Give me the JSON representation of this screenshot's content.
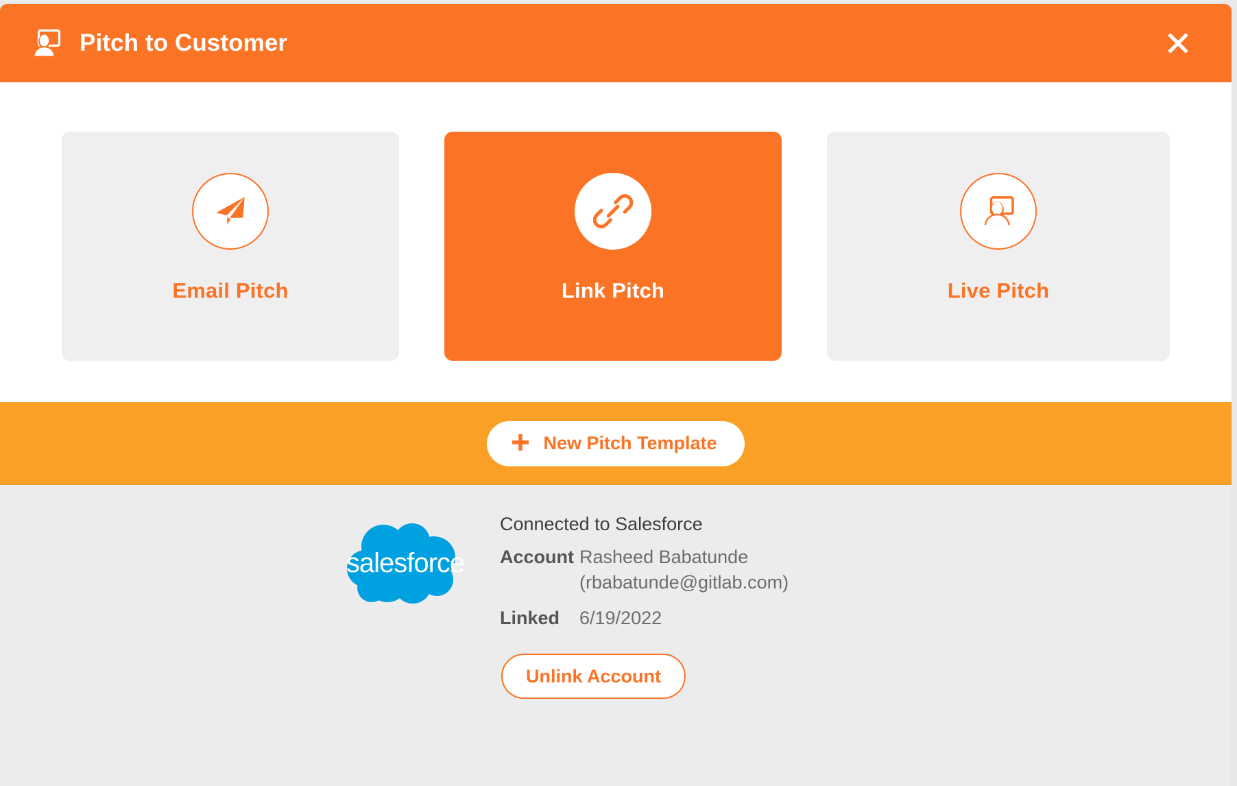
{
  "colors": {
    "header_orange": "#fb7325",
    "band_amber": "#fba026",
    "card_gray": "#efefef",
    "footer_gray": "#ececec",
    "salesforce_blue": "#00a1e0",
    "accent_text": "#fb7325"
  },
  "header": {
    "title": "Pitch to Customer",
    "icon": "presenter-screen-icon",
    "close_icon": "close-icon",
    "close_label": "×"
  },
  "pitch_modes": [
    {
      "id": "email-pitch",
      "label": "Email Pitch",
      "icon": "paper-plane-icon",
      "selected": false
    },
    {
      "id": "link-pitch",
      "label": "Link Pitch",
      "icon": "chain-link-icon",
      "selected": true
    },
    {
      "id": "live-pitch",
      "label": "Live Pitch",
      "icon": "presenter-screen-icon",
      "selected": false
    }
  ],
  "action_band": {
    "new_template_label": "New Pitch Template",
    "plus_icon": "plus-icon"
  },
  "integration": {
    "logo": "salesforce-cloud-logo",
    "logo_text": "salesforce",
    "status": "Connected to Salesforce",
    "account_label": "Account",
    "account_name": "Rasheed Babatunde",
    "account_email": "(rbabatunde@gitlab.com)",
    "linked_label": "Linked",
    "linked_date": "6/19/2022",
    "unlink_label": "Unlink Account"
  }
}
